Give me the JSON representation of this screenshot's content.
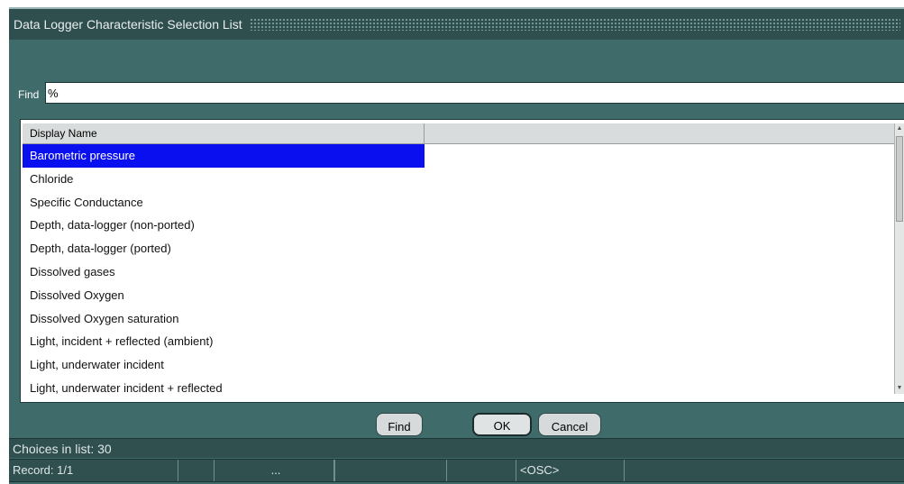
{
  "window": {
    "title": "Data Logger Characteristic Selection List"
  },
  "find": {
    "label": "Find",
    "value": "%"
  },
  "list": {
    "column_header": "Display Name",
    "items": [
      "Barometric pressure",
      "Chloride",
      "Specific Conductance",
      "Depth, data-logger (non-ported)",
      "Depth, data-logger (ported)",
      "Dissolved gases",
      "Dissolved Oxygen",
      "Dissolved Oxygen saturation",
      "Light, incident + reflected (ambient)",
      "Light, underwater incident",
      "Light, underwater incident + reflected"
    ],
    "selected_index": 0
  },
  "buttons": {
    "find": "Find",
    "ok": "OK",
    "cancel": "Cancel"
  },
  "status": {
    "choices": "Choices in list: 30",
    "record": "Record: 1/1",
    "ellipsis": "...",
    "mode": "<OSC>"
  },
  "colors": {
    "background": "#3f6b6a",
    "titlebar": "#2f4f4f",
    "selection": "#0a0ff0"
  }
}
